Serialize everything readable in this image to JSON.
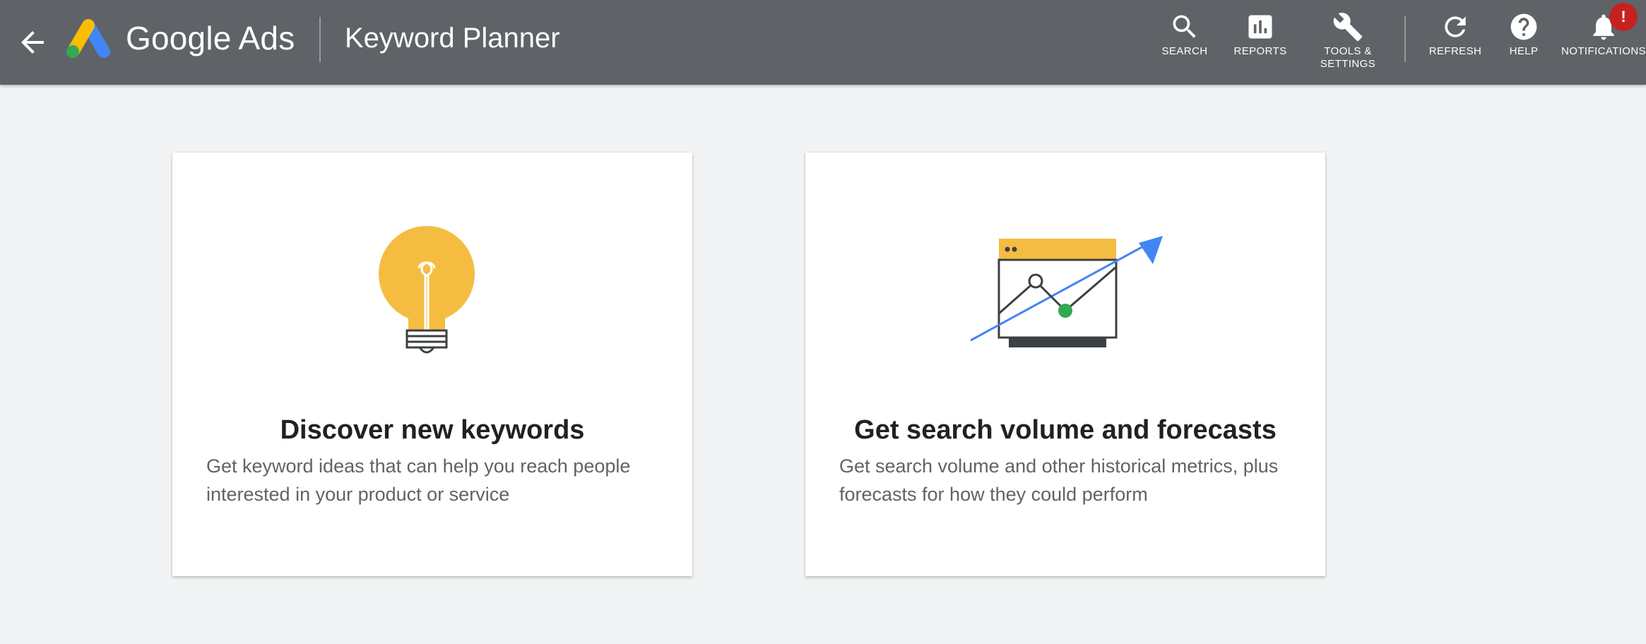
{
  "header": {
    "brand_google": "Google",
    "brand_ads": "Ads",
    "page_title": "Keyword Planner",
    "background_color": "#5f6368"
  },
  "toolbar": {
    "items": [
      {
        "label": "SEARCH",
        "icon": "search-icon"
      },
      {
        "label": "REPORTS",
        "icon": "reports-icon"
      },
      {
        "label": "TOOLS &\nSETTINGS",
        "icon": "wrench-icon"
      },
      {
        "label": "REFRESH",
        "icon": "refresh-icon"
      },
      {
        "label": "HELP",
        "icon": "help-icon"
      },
      {
        "label": "NOTIFICATIONS",
        "icon": "bell-icon"
      }
    ],
    "notification_badge": "!"
  },
  "cards": [
    {
      "title": "Discover new keywords",
      "description": "Get keyword ideas that can help you reach people interested in your product or service",
      "illustration": "lightbulb-icon"
    },
    {
      "title": "Get search volume and forecasts",
      "description": "Get search volume and other historical metrics, plus forecasts for how they could perform",
      "illustration": "trend-chart-icon"
    }
  ],
  "colors": {
    "page_background": "#f1f3f4",
    "yellow": "#f4bd42",
    "blue": "#4285f4",
    "green": "#34a853",
    "badge_red": "#c5221f"
  }
}
